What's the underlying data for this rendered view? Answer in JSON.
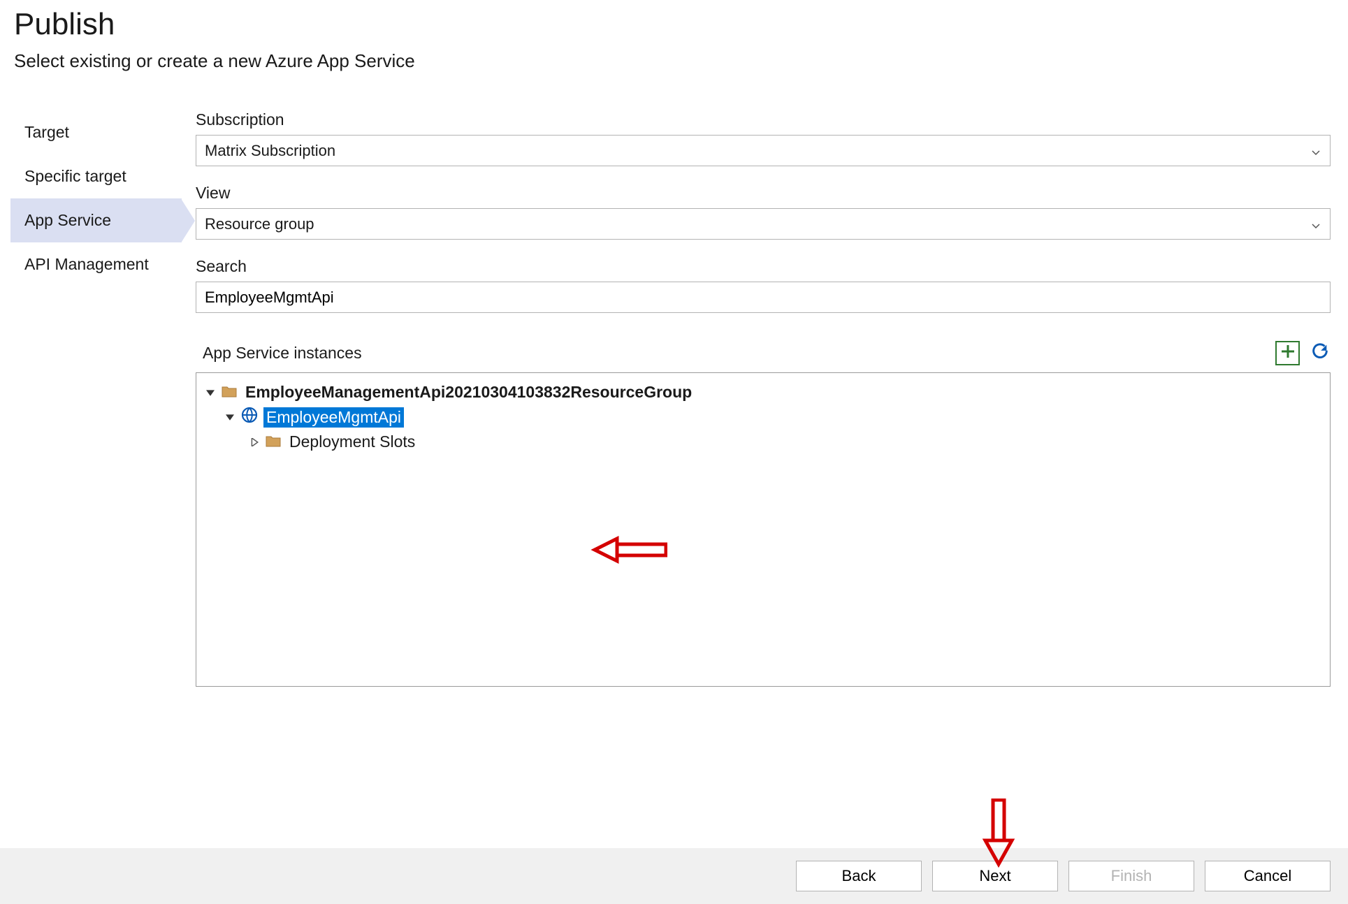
{
  "header": {
    "title": "Publish",
    "subtitle": "Select existing or create a new Azure App Service"
  },
  "sidebar": {
    "items": [
      {
        "label": "Target"
      },
      {
        "label": "Specific target"
      },
      {
        "label": "App Service"
      },
      {
        "label": "API Management"
      }
    ]
  },
  "form": {
    "subscription_label": "Subscription",
    "subscription_value": "Matrix Subscription",
    "view_label": "View",
    "view_value": "Resource group",
    "search_label": "Search",
    "search_value": "EmployeeMgmtApi",
    "instances_label": "App Service instances"
  },
  "tree": {
    "root": {
      "label": "EmployeeManagementApi20210304103832ResourceGroup"
    },
    "app": {
      "label": "EmployeeMgmtApi"
    },
    "slots": {
      "label": "Deployment Slots"
    }
  },
  "footer": {
    "back": "Back",
    "next": "Next",
    "finish": "Finish",
    "cancel": "Cancel"
  }
}
